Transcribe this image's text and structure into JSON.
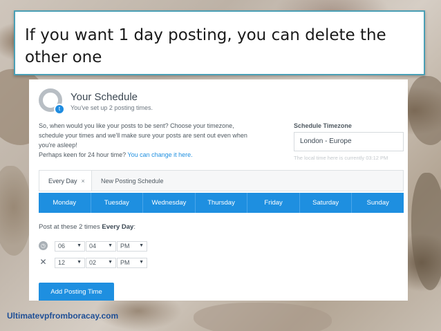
{
  "callout": {
    "text": "If you want 1 day posting, you can delete the other one"
  },
  "schedule": {
    "title": "Your Schedule",
    "subtitle": "You've set up 2 posting times.",
    "description_line1": "So, when would you like your posts to be sent? Choose your timezone,",
    "description_line2": "schedule your times and we'll make sure your posts are sent out even when",
    "description_line3": "you're asleep!",
    "description_line4": "Perhaps keen for 24 hour time?",
    "change_link": "You can change it here."
  },
  "timezone": {
    "label": "Schedule Timezone",
    "value": "London - Europe",
    "note": "The local time here is currently 03:12 PM"
  },
  "tabs": [
    {
      "label": "Every Day",
      "close": "×"
    },
    {
      "label": "New Posting Schedule"
    }
  ],
  "days": [
    "Monday",
    "Tuesday",
    "Wednesday",
    "Thursday",
    "Friday",
    "Saturday",
    "Sunday"
  ],
  "post_at": {
    "prefix": "Post at these 2 times",
    "emphasis": "Every Day",
    "suffix": ":"
  },
  "times": [
    {
      "icon": "clock-icon",
      "hour": "06",
      "minute": "04",
      "ampm": "PM"
    },
    {
      "icon": "close-icon",
      "hour": "12",
      "minute": "02",
      "ampm": "PM"
    }
  ],
  "add_button": "Add Posting Time",
  "footer": "Ultimatevpfromboracay.com",
  "colors": {
    "accent": "#1e8fe0",
    "callout_border": "#4a9fb5",
    "footer": "#1f4f96"
  }
}
